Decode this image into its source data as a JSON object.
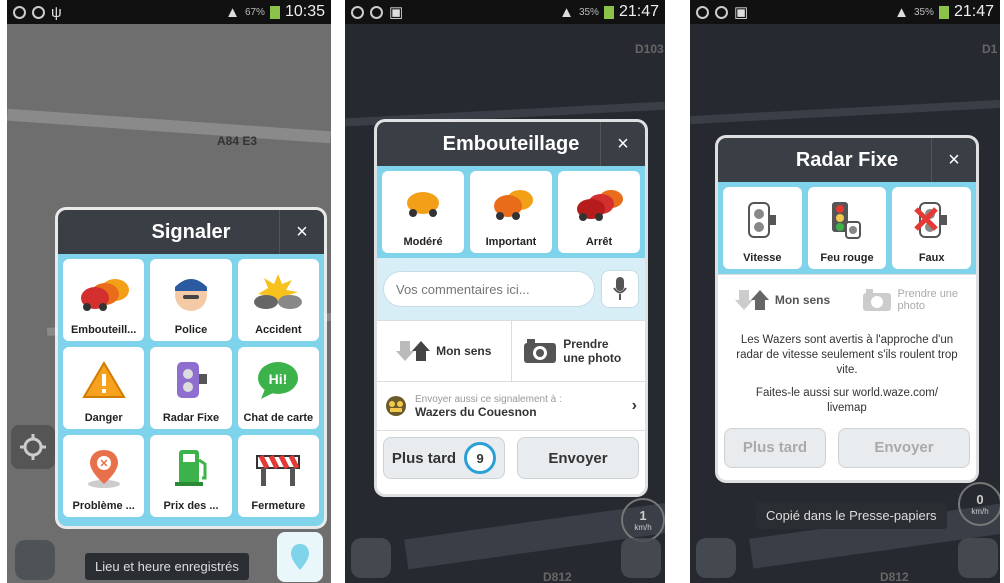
{
  "screen1": {
    "status": {
      "time": "10:35",
      "battery": "67%"
    },
    "map_labels": {
      "road_a": "A84",
      "road_e": "E3"
    },
    "dialog": {
      "title": "Signaler",
      "close": "×",
      "tiles": [
        {
          "label": "Embouteill...",
          "icon": "traffic-jam-icon"
        },
        {
          "label": "Police",
          "icon": "police-icon"
        },
        {
          "label": "Accident",
          "icon": "accident-icon"
        },
        {
          "label": "Danger",
          "icon": "danger-icon"
        },
        {
          "label": "Radar Fixe",
          "icon": "speed-camera-icon"
        },
        {
          "label": "Chat de carte",
          "icon": "map-chat-icon"
        },
        {
          "label": "Problème ...",
          "icon": "map-problem-icon"
        },
        {
          "label": "Prix des ...",
          "icon": "gas-price-icon"
        },
        {
          "label": "Fermeture",
          "icon": "road-closure-icon"
        }
      ]
    },
    "toast": "Lieu et heure enregistrés"
  },
  "screen2": {
    "status": {
      "time": "21:47",
      "battery": "35%"
    },
    "map_label": "D103",
    "map_label_bottom": "D812",
    "speed": {
      "value": "1",
      "unit": "km/h"
    },
    "dialog": {
      "title": "Embouteillage",
      "close": "×",
      "tiles": [
        {
          "label": "Modéré",
          "icon": "car-icon"
        },
        {
          "label": "Important",
          "icon": "cars-icon"
        },
        {
          "label": "Arrêt",
          "icon": "stopped-cars-icon"
        }
      ],
      "comment_placeholder": "Vos commentaires ici...",
      "direction": "Mon sens",
      "photo": "Prendre une photo",
      "send_also_label": "Envoyer aussi ce signalement à :",
      "group": "Wazers du Couesnon",
      "later": "Plus tard",
      "countdown": "9",
      "send": "Envoyer"
    }
  },
  "screen3": {
    "status": {
      "time": "21:47",
      "battery": "35%"
    },
    "map_label": "D1",
    "map_label_bottom": "D812",
    "speed": {
      "value": "0",
      "unit": "km/h"
    },
    "dialog": {
      "title": "Radar Fixe",
      "close": "×",
      "tiles": [
        {
          "label": "Vitesse",
          "icon": "speed-camera-icon"
        },
        {
          "label": "Feu rouge",
          "icon": "red-light-camera-icon"
        },
        {
          "label": "Faux",
          "icon": "false-camera-icon"
        }
      ],
      "direction": "Mon sens",
      "photo": "Prendre une photo",
      "info": "Les Wazers sont avertis à l'approche d'un radar de vitesse seulement s'ils roulent trop vite.",
      "info2": "Faites-le aussi sur world.waze.com/ livemap",
      "later": "Plus tard",
      "send": "Envoyer"
    },
    "toast": "Copié dans le Presse-papiers"
  }
}
